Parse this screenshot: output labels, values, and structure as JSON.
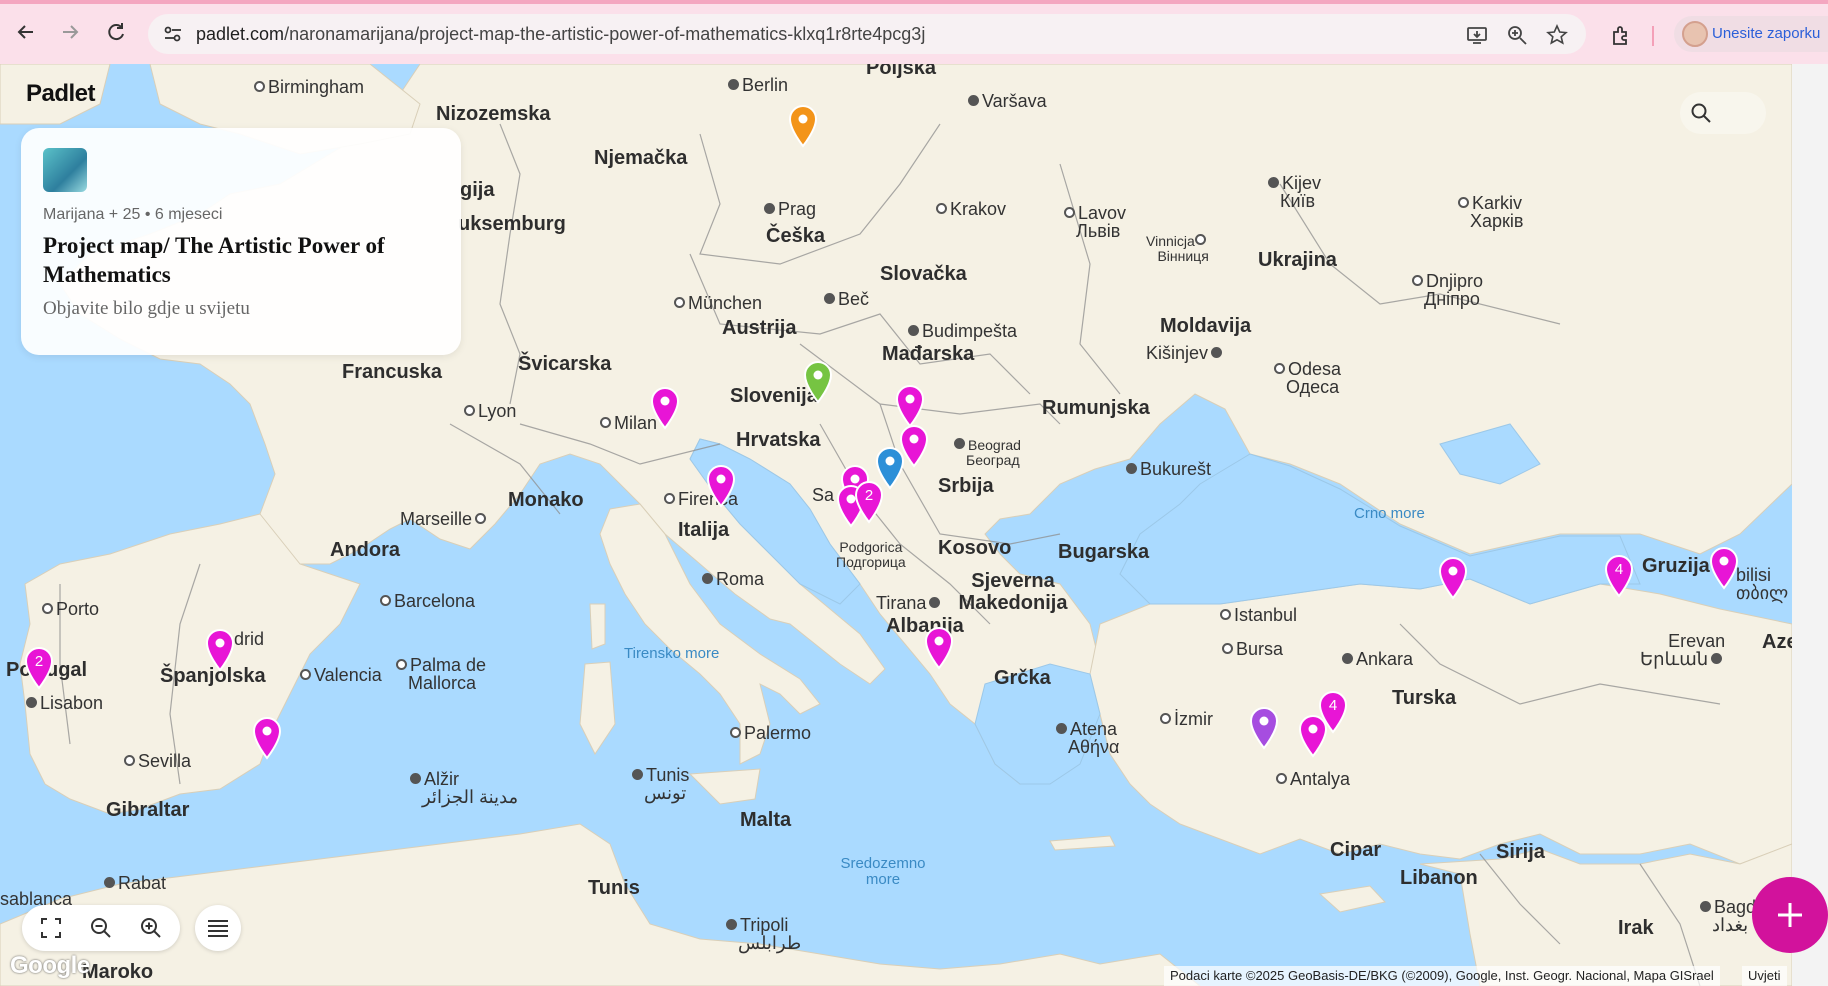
{
  "browser": {
    "url_host": "padlet.com",
    "url_path": "/naronamarijana/project-map-the-artistic-power-of-mathematics-klxq1r8rte4pcg3j",
    "profile_label": "Unesite zaporku"
  },
  "padlet": {
    "logo": "Padlet",
    "card": {
      "meta": "Marijana + 25 • 6 mjeseci",
      "title": "Project map/ The Artistic Power of Mathematics",
      "subtitle": "Objavite bilo gdje u svijetu"
    }
  },
  "map": {
    "countries": [
      "Poljska",
      "Nizozemska",
      "Njemačka",
      "gija",
      "uksemburg",
      "Češka",
      "Slovačka",
      "Ukrajina",
      "Austrija",
      "Mađarska",
      "Moldavija",
      "Francuska",
      "Švicarska",
      "Slovenija",
      "Hrvatska",
      "Rumunjska",
      "Srbija",
      "Monako",
      "Italija",
      "Kosovo",
      "Bugarska",
      "Sjeverna Makedonija",
      "Andora",
      "Albanija",
      "Gruzija",
      "Azer",
      "Portugal",
      "Španjolska",
      "Grčka",
      "Turska",
      "Gibraltar",
      "Malta",
      "Tunis",
      "Cipar",
      "Sirija",
      "Libanon",
      "Irak",
      "Maroko"
    ],
    "cities": [
      "Birmingham",
      "Berlin",
      "Varšava",
      "Kijev",
      "Київ",
      "Prag",
      "Krakov",
      "Lavov",
      "Львів",
      "Karkiv",
      "Харків",
      "Vinnicja",
      "Вінниця",
      "Dnjipro",
      "Дніпро",
      "München",
      "Beč",
      "Budimpešta",
      "Kišinjev",
      "Odesa",
      "Одеса",
      "Lyon",
      "Milan",
      "Beograd",
      "Београд",
      "Bukurešt",
      "Marseille",
      "Firenca",
      "Sa",
      "Podgorica",
      "Подгорица",
      "Roma",
      "Tirana",
      "Istanbul",
      "Barcelona",
      "Porto",
      "drid",
      "Bursa",
      "Ankara",
      "Erevan",
      "Երևան",
      "Valencia",
      "Palma de",
      "Mallorca",
      "Lisabon",
      "İzmir",
      "Atena",
      "Αθήνα",
      "Palermo",
      "Sevilla",
      "Alžir",
      "مدينة الجزائر",
      "Tunis",
      "تونس",
      "Antalya",
      "Rabat",
      "sablanca",
      "Tripoli",
      "طرابلس",
      "Bagd",
      "بغداد",
      "bilisi",
      "თბილ"
    ],
    "seas": [
      "Crno more",
      "Tirensko more",
      "Sredozemno more"
    ],
    "cluster_counts": [
      "2",
      "4",
      "2",
      "4"
    ],
    "attribution": "Podaci karte ©2025 GeoBasis-DE/BKG (©2009), Google, Inst. Geogr. Nacional, Mapa GISrael",
    "terms": "Uvjeti",
    "google": "Google"
  },
  "colors": {
    "water": "#aadaff",
    "land": "#f5f1e4",
    "pin_magenta": "#e815d6",
    "pin_orange": "#f39419",
    "pin_green": "#76c442",
    "pin_blue": "#2c8fd8",
    "pin_purple": "#a64de0",
    "fab": "#d2129c"
  }
}
